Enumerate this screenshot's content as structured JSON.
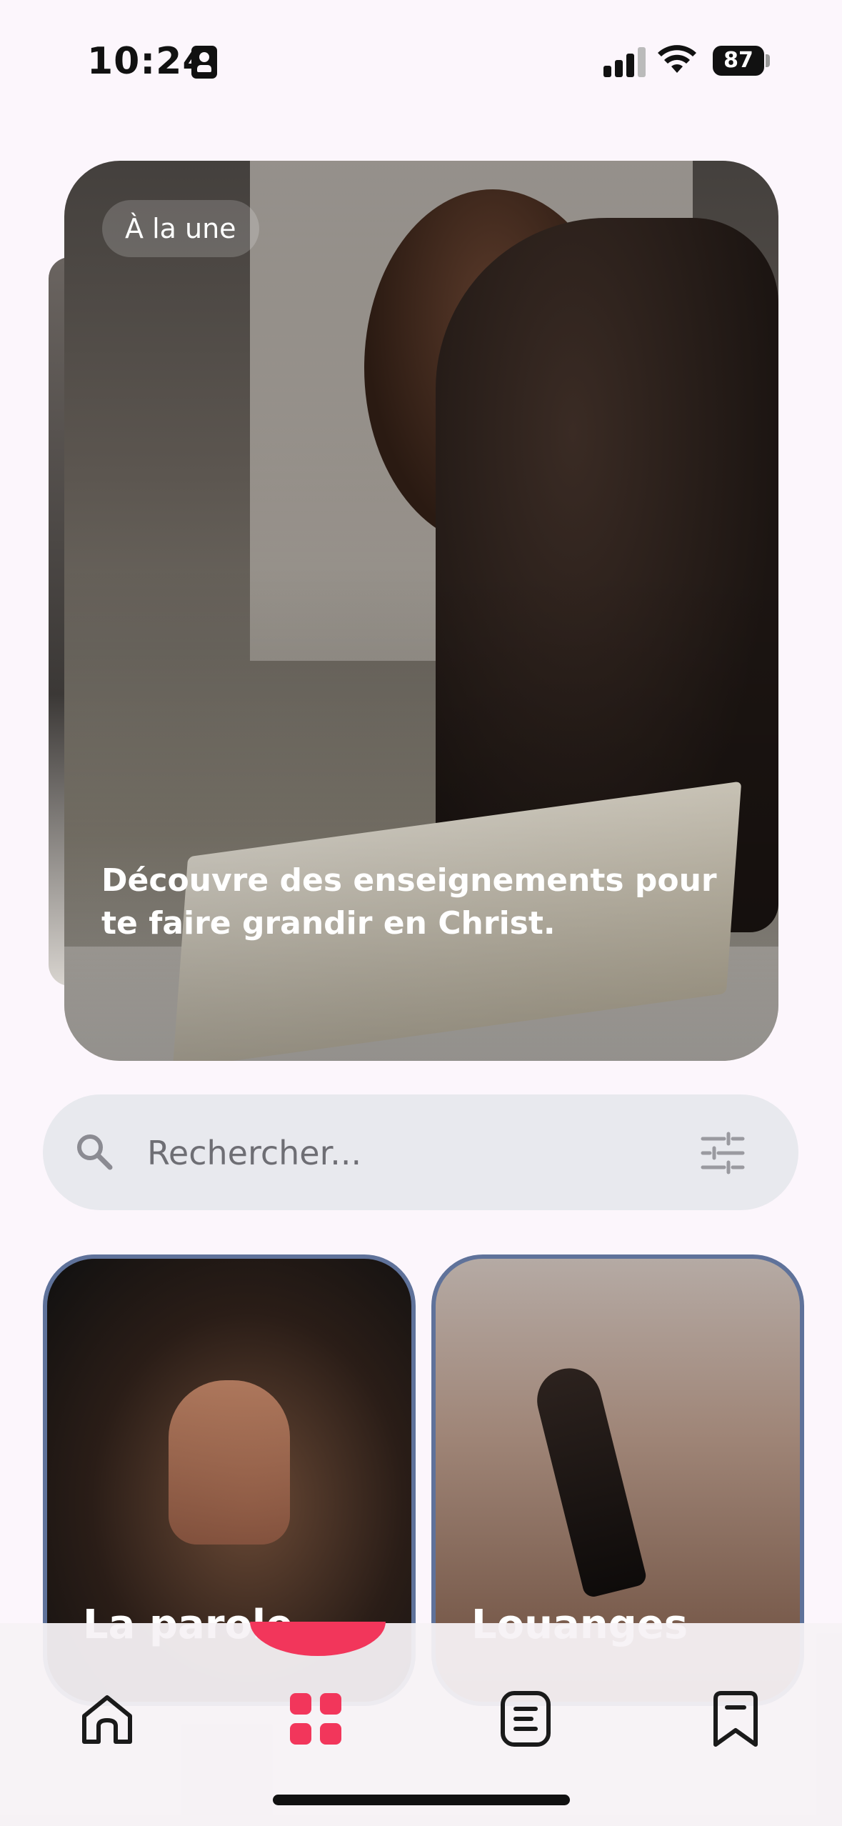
{
  "status_bar": {
    "time": "10:24",
    "battery": "87"
  },
  "featured": {
    "badge": "À la une",
    "caption": "Découvre des enseignements pour te faire grandir en Christ."
  },
  "search": {
    "placeholder": "Rechercher..."
  },
  "categories": [
    {
      "title": "La parole"
    },
    {
      "title": "Louanges"
    }
  ],
  "nav": {
    "items": [
      "home-icon",
      "grid-icon",
      "document-icon",
      "bookmark-icon"
    ],
    "active": "grid-icon",
    "accent": "#f2365b"
  },
  "colors": {
    "background": "#fcf6fc",
    "card_border": "#5f729a",
    "search_bg": "#e8e9ee"
  }
}
